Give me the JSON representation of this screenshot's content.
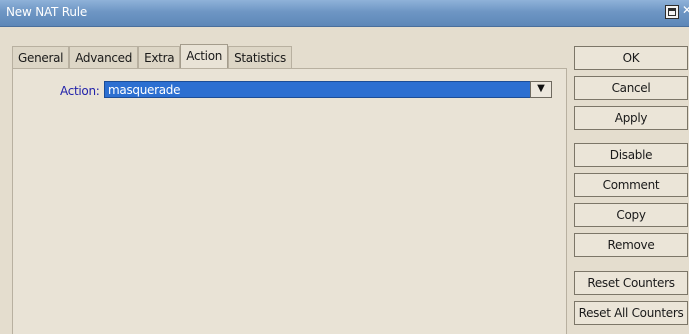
{
  "window": {
    "title": "New NAT Rule",
    "controls": [
      "maximize-icon",
      "close-icon"
    ]
  },
  "tabs": [
    {
      "label": "General",
      "active": false
    },
    {
      "label": "Advanced",
      "active": false
    },
    {
      "label": "Extra",
      "active": false
    },
    {
      "label": "Action",
      "active": true
    },
    {
      "label": "Statistics",
      "active": false
    }
  ],
  "action_field": {
    "label": "Action:",
    "value": "masquerade",
    "dropdown_icon": "dropdown-arrow-icon"
  },
  "buttons": {
    "ok": "OK",
    "cancel": "Cancel",
    "apply": "Apply",
    "disable": "Disable",
    "comment": "Comment",
    "copy": "Copy",
    "remove": "Remove",
    "reset_counters": "Reset Counters",
    "reset_all_counters": "Reset All Counters"
  },
  "colors": {
    "titlebar": "#6e96c4",
    "selection": "#2c6fd1",
    "label": "#2222aa",
    "background": "#e4ddce"
  }
}
